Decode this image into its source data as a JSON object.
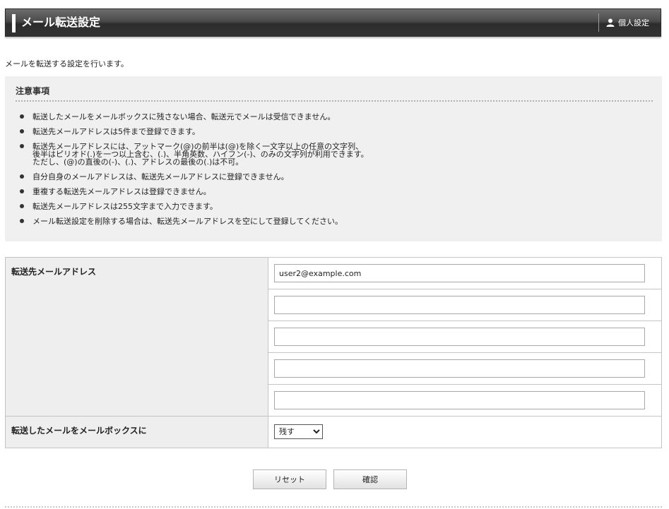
{
  "header": {
    "title": "メール転送設定",
    "personal_settings_label": "個人設定",
    "personal_settings_icon": "user-icon"
  },
  "intro_text": "メールを転送する設定を行います。",
  "notice": {
    "heading": "注意事項",
    "items": [
      [
        "転送したメールをメールボックスに残さない場合、転送元でメールは受信できません。"
      ],
      [
        "転送先メールアドレスは5件まで登録できます。"
      ],
      [
        "転送先メールアドレスには、アットマーク(@)の前半は(@)を除く一文字以上の任意の文字列、",
        "後半はピリオド(.)を一つ以上含む、(.)、半角英数、ハイフン(-)、のみの文字列が利用できます。",
        "ただし、(@)の直後の(-)、(.)、アドレスの最後の(.)は不可。"
      ],
      [
        "自分自身のメールアドレスは、転送先メールアドレスに登録できません。"
      ],
      [
        "重複する転送先メールアドレスは登録できません。"
      ],
      [
        "転送先メールアドレスは255文字まで入力できます。"
      ],
      [
        "メール転送設定を削除する場合は、転送先メールアドレスを空にして登録してください。"
      ]
    ]
  },
  "form": {
    "address_label": "転送先メールアドレス",
    "addresses": [
      "user2@example.com",
      "",
      "",
      "",
      ""
    ],
    "keep_label": "転送したメールをメールボックスに",
    "keep_selected": "残す"
  },
  "buttons": {
    "reset": "リセット",
    "confirm": "確認"
  }
}
